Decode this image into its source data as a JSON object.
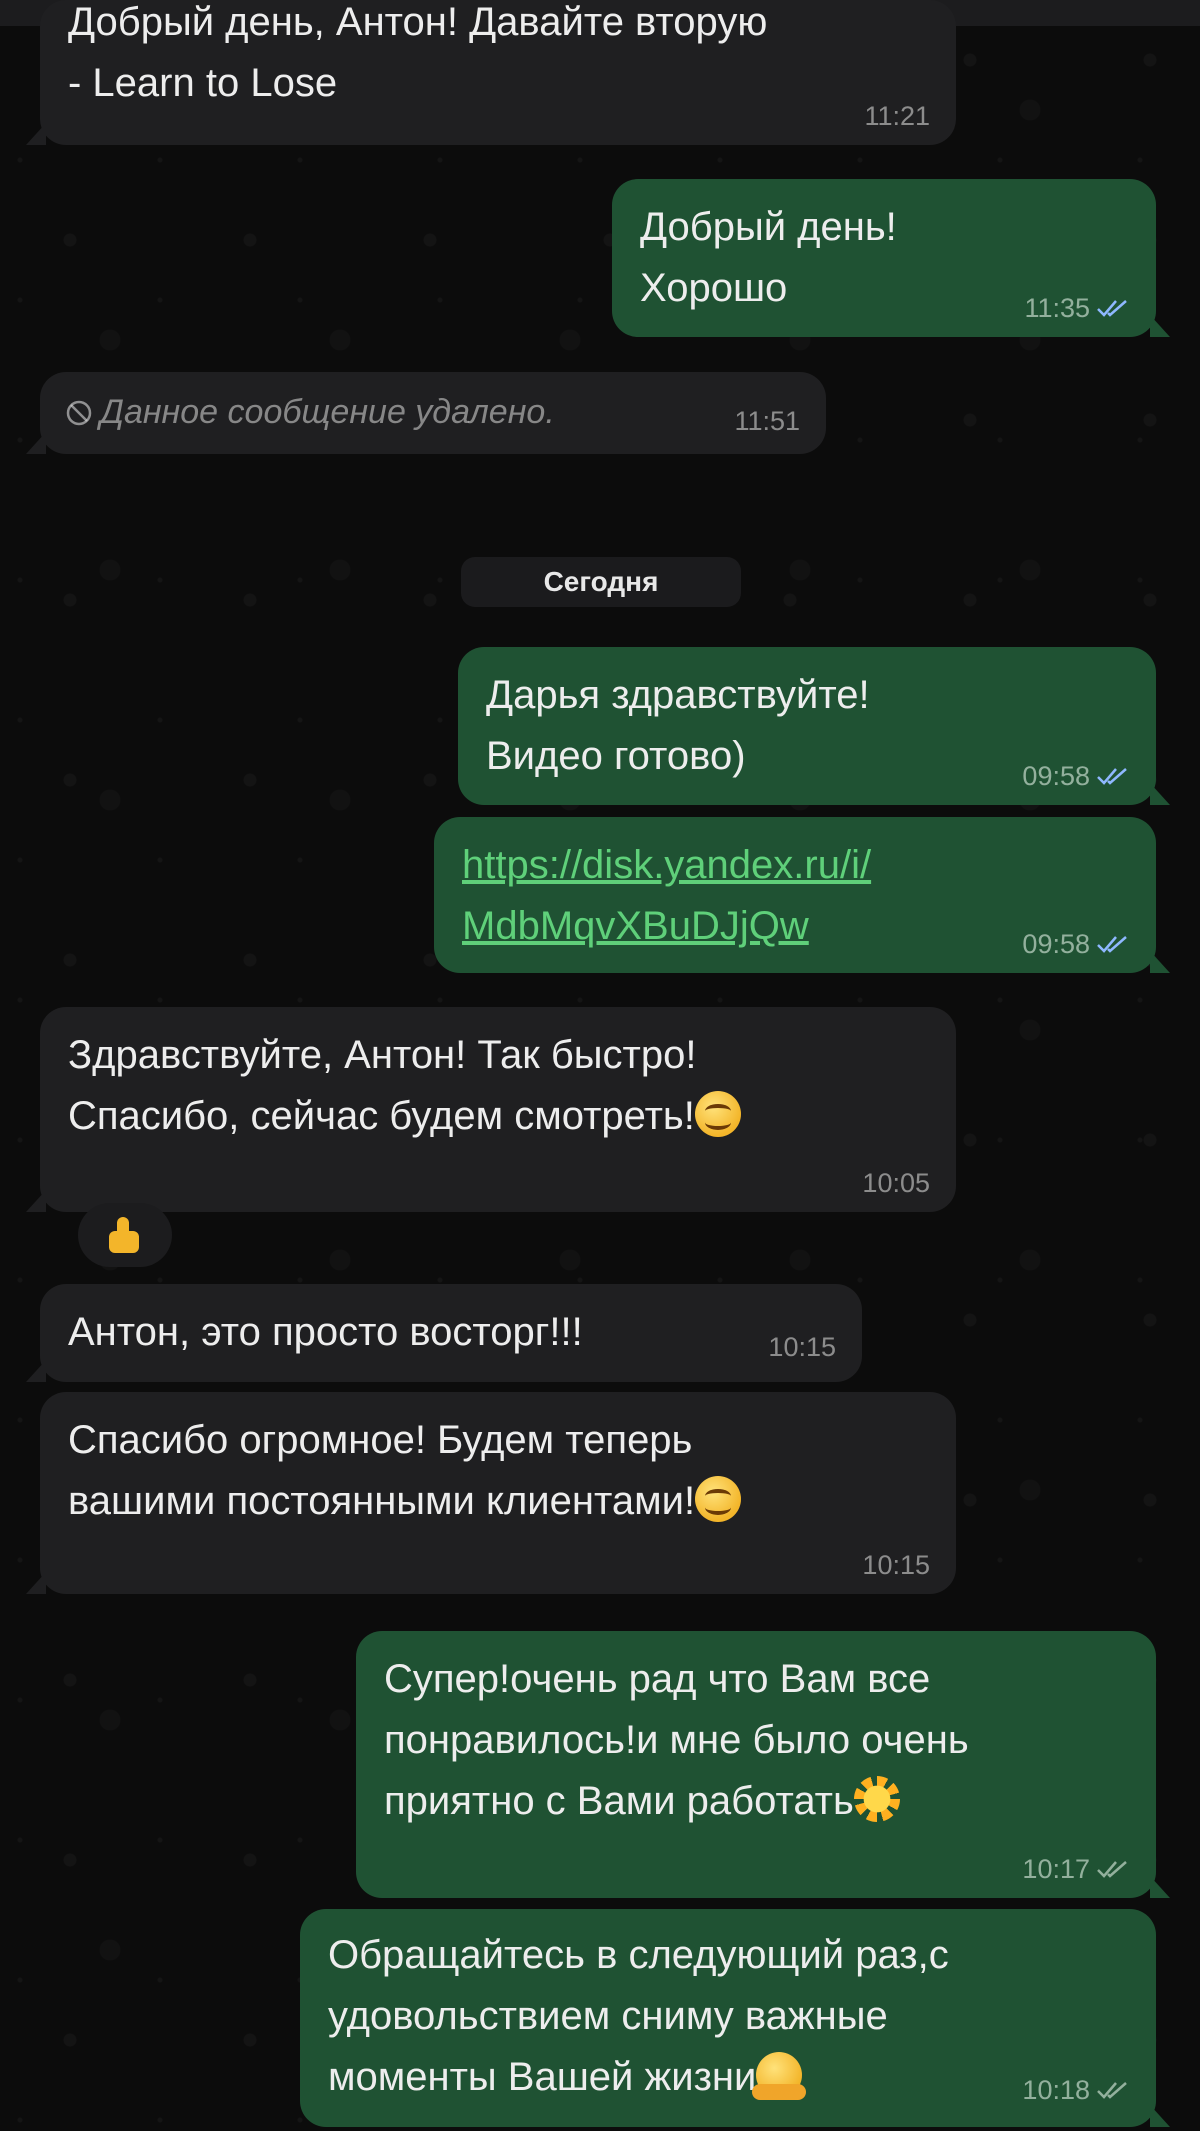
{
  "colors": {
    "incoming_bubble": "#1f1f21",
    "outgoing_bubble": "#1f5233",
    "link": "#5fd07a",
    "background": "#0c0c0c"
  },
  "date_separator": "Сегодня",
  "messages": [
    {
      "id": "m1",
      "direction": "in",
      "lines": [
        "Добрый день, Антон! Давайте вторую",
        "- Learn to Lose"
      ],
      "time": "11:21"
    },
    {
      "id": "m2",
      "direction": "out",
      "lines": [
        "Добрый день!",
        "Хорошо"
      ],
      "time": "11:35",
      "status_icon": "double-check-icon"
    },
    {
      "id": "m3",
      "direction": "in",
      "deleted": true,
      "text": "Данное сообщение удалено.",
      "time": "11:51",
      "icon": "prohibited-icon"
    },
    {
      "id": "m4",
      "direction": "out",
      "lines": [
        "Дарья здравствуйте!",
        "Видео готово)"
      ],
      "time": "09:58",
      "status_icon": "double-check-icon"
    },
    {
      "id": "m5",
      "direction": "out",
      "link_lines": [
        "https://disk.yandex.ru/i/",
        "MdbMqvXBuDJjQw"
      ],
      "time": "09:58",
      "status_icon": "double-check-icon"
    },
    {
      "id": "m6",
      "direction": "in",
      "lines": [
        "Здравствуйте, Антон! Так быстро!",
        "Спасибо, сейчас будем смотреть!"
      ],
      "emoji": "smiling-face-icon",
      "time": "10:05"
    },
    {
      "id": "m7",
      "direction": "in",
      "lines": [
        "Антон, это просто восторг!!!"
      ],
      "time": "10:15"
    },
    {
      "id": "m8",
      "direction": "in",
      "lines": [
        "Спасибо огромное! Будем теперь",
        "вашими постоянными клиентами!"
      ],
      "emoji": "smiling-face-icon",
      "time": "10:15"
    },
    {
      "id": "m9",
      "direction": "out",
      "lines": [
        "Супер!очень рад что Вам все",
        "понравилось!и мне было очень",
        "приятно с Вами работать"
      ],
      "emoji": "sun-icon",
      "time": "10:17",
      "status_icon": "double-check-icon"
    },
    {
      "id": "m10",
      "direction": "out",
      "lines": [
        "Обращайтесь в следующий раз,с",
        "удовольствием сниму важные",
        "моменты Вашей жизни"
      ],
      "emoji": "hugging-face-icon",
      "time": "10:18",
      "status_icon": "double-check-icon"
    }
  ],
  "reaction": {
    "emoji": "thumbs-up-icon",
    "on_message": "m6"
  }
}
